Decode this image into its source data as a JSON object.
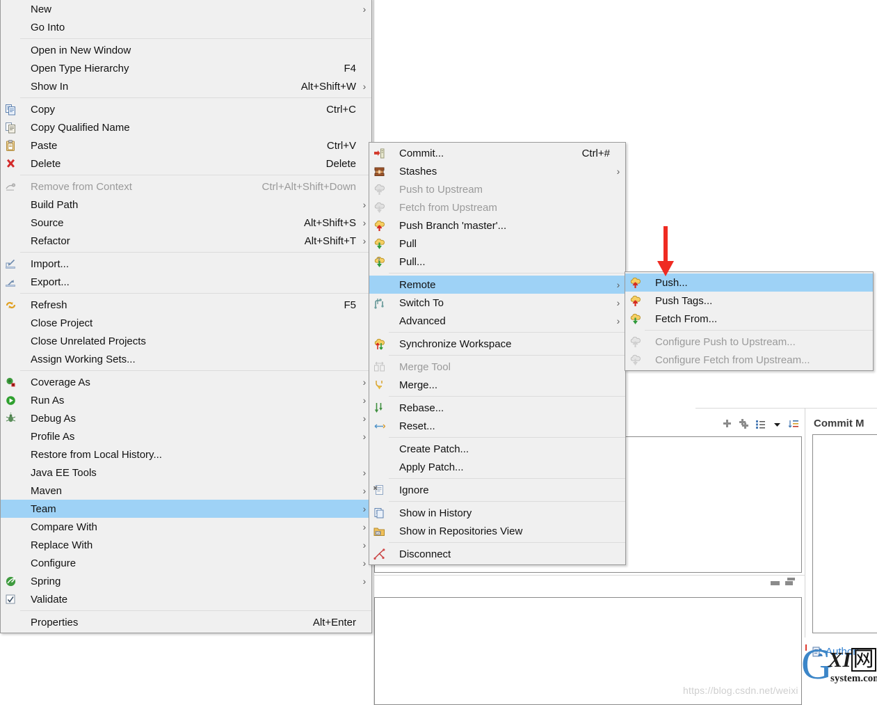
{
  "context_menu": {
    "name": "project-context-menu",
    "groups": [
      {
        "items": [
          {
            "label": "New",
            "icon": "none",
            "accel": "",
            "submenu": true,
            "disabled": false,
            "selected": false
          },
          {
            "label": "Go Into",
            "icon": "none",
            "accel": "",
            "submenu": false,
            "disabled": false,
            "selected": false
          }
        ]
      },
      {
        "items": [
          {
            "label": "Open in New Window",
            "icon": "none",
            "accel": "",
            "submenu": false,
            "disabled": false,
            "selected": false
          },
          {
            "label": "Open Type Hierarchy",
            "icon": "none",
            "accel": "F4",
            "submenu": false,
            "disabled": false,
            "selected": false
          },
          {
            "label": "Show In",
            "icon": "none",
            "accel": "Alt+Shift+W",
            "submenu": true,
            "disabled": false,
            "selected": false
          }
        ]
      },
      {
        "items": [
          {
            "label": "Copy",
            "icon": "copy-icon",
            "accel": "Ctrl+C",
            "submenu": false,
            "disabled": false,
            "selected": false
          },
          {
            "label": "Copy Qualified Name",
            "icon": "copy-qualified-icon",
            "accel": "",
            "submenu": false,
            "disabled": false,
            "selected": false
          },
          {
            "label": "Paste",
            "icon": "paste-icon",
            "accel": "Ctrl+V",
            "submenu": false,
            "disabled": false,
            "selected": false
          },
          {
            "label": "Delete",
            "icon": "delete-icon",
            "accel": "Delete",
            "submenu": false,
            "disabled": false,
            "selected": false
          }
        ]
      },
      {
        "items": [
          {
            "label": "Remove from Context",
            "icon": "remove-context-icon",
            "accel": "Ctrl+Alt+Shift+Down",
            "submenu": false,
            "disabled": true,
            "selected": false
          },
          {
            "label": "Build Path",
            "icon": "none",
            "accel": "",
            "submenu": true,
            "disabled": false,
            "selected": false
          },
          {
            "label": "Source",
            "icon": "none",
            "accel": "Alt+Shift+S",
            "submenu": true,
            "disabled": false,
            "selected": false
          },
          {
            "label": "Refactor",
            "icon": "none",
            "accel": "Alt+Shift+T",
            "submenu": true,
            "disabled": false,
            "selected": false
          }
        ]
      },
      {
        "items": [
          {
            "label": "Import...",
            "icon": "import-icon",
            "accel": "",
            "submenu": false,
            "disabled": false,
            "selected": false
          },
          {
            "label": "Export...",
            "icon": "export-icon",
            "accel": "",
            "submenu": false,
            "disabled": false,
            "selected": false
          }
        ]
      },
      {
        "items": [
          {
            "label": "Refresh",
            "icon": "refresh-icon",
            "accel": "F5",
            "submenu": false,
            "disabled": false,
            "selected": false
          },
          {
            "label": "Close Project",
            "icon": "none",
            "accel": "",
            "submenu": false,
            "disabled": false,
            "selected": false
          },
          {
            "label": "Close Unrelated Projects",
            "icon": "none",
            "accel": "",
            "submenu": false,
            "disabled": false,
            "selected": false
          },
          {
            "label": "Assign Working Sets...",
            "icon": "none",
            "accel": "",
            "submenu": false,
            "disabled": false,
            "selected": false
          }
        ]
      },
      {
        "items": [
          {
            "label": "Coverage As",
            "icon": "coverage-icon",
            "accel": "",
            "submenu": true,
            "disabled": false,
            "selected": false
          },
          {
            "label": "Run As",
            "icon": "run-icon",
            "accel": "",
            "submenu": true,
            "disabled": false,
            "selected": false
          },
          {
            "label": "Debug As",
            "icon": "debug-icon",
            "accel": "",
            "submenu": true,
            "disabled": false,
            "selected": false
          },
          {
            "label": "Profile As",
            "icon": "none",
            "accel": "",
            "submenu": true,
            "disabled": false,
            "selected": false
          },
          {
            "label": "Restore from Local History...",
            "icon": "none",
            "accel": "",
            "submenu": false,
            "disabled": false,
            "selected": false
          },
          {
            "label": "Java EE Tools",
            "icon": "none",
            "accel": "",
            "submenu": true,
            "disabled": false,
            "selected": false
          },
          {
            "label": "Maven",
            "icon": "none",
            "accel": "",
            "submenu": true,
            "disabled": false,
            "selected": false
          },
          {
            "label": "Team",
            "icon": "none",
            "accel": "",
            "submenu": true,
            "disabled": false,
            "selected": true
          },
          {
            "label": "Compare With",
            "icon": "none",
            "accel": "",
            "submenu": true,
            "disabled": false,
            "selected": false
          },
          {
            "label": "Replace With",
            "icon": "none",
            "accel": "",
            "submenu": true,
            "disabled": false,
            "selected": false
          },
          {
            "label": "Configure",
            "icon": "none",
            "accel": "",
            "submenu": true,
            "disabled": false,
            "selected": false
          },
          {
            "label": "Spring",
            "icon": "spring-icon",
            "accel": "",
            "submenu": true,
            "disabled": false,
            "selected": false
          },
          {
            "label": "Validate",
            "icon": "validate-checkbox-icon",
            "accel": "",
            "submenu": false,
            "disabled": false,
            "selected": false
          }
        ]
      },
      {
        "items": [
          {
            "label": "Properties",
            "icon": "none",
            "accel": "Alt+Enter",
            "submenu": false,
            "disabled": false,
            "selected": false
          }
        ]
      }
    ]
  },
  "team_menu": {
    "name": "team-submenu",
    "groups": [
      {
        "items": [
          {
            "label": "Commit...",
            "icon": "commit-icon",
            "accel": "Ctrl+#",
            "submenu": false,
            "disabled": false,
            "selected": false
          },
          {
            "label": "Stashes",
            "icon": "stashes-icon",
            "accel": "",
            "submenu": true,
            "disabled": false,
            "selected": false
          },
          {
            "label": "Push to Upstream",
            "icon": "push-upstream-icon",
            "accel": "",
            "submenu": false,
            "disabled": true,
            "selected": false
          },
          {
            "label": "Fetch from Upstream",
            "icon": "fetch-upstream-icon",
            "accel": "",
            "submenu": false,
            "disabled": true,
            "selected": false
          },
          {
            "label": "Push Branch 'master'...",
            "icon": "push-branch-icon",
            "accel": "",
            "submenu": false,
            "disabled": false,
            "selected": false
          },
          {
            "label": "Pull",
            "icon": "pull-icon",
            "accel": "",
            "submenu": false,
            "disabled": false,
            "selected": false
          },
          {
            "label": "Pull...",
            "icon": "pull-config-icon",
            "accel": "",
            "submenu": false,
            "disabled": false,
            "selected": false
          }
        ]
      },
      {
        "items": [
          {
            "label": "Remote",
            "icon": "none",
            "accel": "",
            "submenu": true,
            "disabled": false,
            "selected": true
          },
          {
            "label": "Switch To",
            "icon": "switch-to-icon",
            "accel": "",
            "submenu": true,
            "disabled": false,
            "selected": false
          },
          {
            "label": "Advanced",
            "icon": "none",
            "accel": "",
            "submenu": true,
            "disabled": false,
            "selected": false
          }
        ]
      },
      {
        "items": [
          {
            "label": "Synchronize Workspace",
            "icon": "synchronize-icon",
            "accel": "",
            "submenu": false,
            "disabled": false,
            "selected": false
          }
        ]
      },
      {
        "items": [
          {
            "label": "Merge Tool",
            "icon": "merge-tool-icon",
            "accel": "",
            "submenu": false,
            "disabled": true,
            "selected": false
          },
          {
            "label": "Merge...",
            "icon": "merge-icon",
            "accel": "",
            "submenu": false,
            "disabled": false,
            "selected": false
          }
        ]
      },
      {
        "items": [
          {
            "label": "Rebase...",
            "icon": "rebase-icon",
            "accel": "",
            "submenu": false,
            "disabled": false,
            "selected": false
          },
          {
            "label": "Reset...",
            "icon": "reset-icon",
            "accel": "",
            "submenu": false,
            "disabled": false,
            "selected": false
          }
        ]
      },
      {
        "items": [
          {
            "label": "Create Patch...",
            "icon": "none",
            "accel": "",
            "submenu": false,
            "disabled": false,
            "selected": false
          },
          {
            "label": "Apply Patch...",
            "icon": "none",
            "accel": "",
            "submenu": false,
            "disabled": false,
            "selected": false
          }
        ]
      },
      {
        "items": [
          {
            "label": "Ignore",
            "icon": "ignore-icon",
            "accel": "",
            "submenu": false,
            "disabled": false,
            "selected": false
          }
        ]
      },
      {
        "items": [
          {
            "label": "Show in History",
            "icon": "history-icon",
            "accel": "",
            "submenu": false,
            "disabled": false,
            "selected": false
          },
          {
            "label": "Show in Repositories View",
            "icon": "repositories-icon",
            "accel": "",
            "submenu": false,
            "disabled": false,
            "selected": false
          }
        ]
      },
      {
        "items": [
          {
            "label": "Disconnect",
            "icon": "disconnect-icon",
            "accel": "",
            "submenu": false,
            "disabled": false,
            "selected": false
          }
        ]
      }
    ]
  },
  "remote_menu": {
    "name": "remote-submenu",
    "groups": [
      {
        "items": [
          {
            "label": "Push...",
            "icon": "push-icon",
            "accel": "",
            "submenu": false,
            "disabled": false,
            "selected": true
          },
          {
            "label": "Push Tags...",
            "icon": "push-tags-icon",
            "accel": "",
            "submenu": false,
            "disabled": false,
            "selected": false
          },
          {
            "label": "Fetch From...",
            "icon": "fetch-from-icon",
            "accel": "",
            "submenu": false,
            "disabled": false,
            "selected": false
          }
        ]
      },
      {
        "items": [
          {
            "label": "Configure Push to Upstream...",
            "icon": "configure-push-icon",
            "accel": "",
            "submenu": false,
            "disabled": true,
            "selected": false
          },
          {
            "label": "Configure Fetch from Upstream...",
            "icon": "configure-fetch-icon",
            "accel": "",
            "submenu": false,
            "disabled": true,
            "selected": false
          }
        ]
      }
    ]
  },
  "workbench": {
    "commit_panel_title": "Commit M",
    "author_label": "Author:"
  },
  "watermarks": {
    "url": "https://blog.csdn.net/weixi",
    "logo_g": "G",
    "logo_xi": "XI",
    "logo_wang": "网",
    "logo_domain": "system.com"
  },
  "colors": {
    "menu_bg": "#f0f0f0",
    "menu_border": "#9a9a9a",
    "highlight": "#9ed2f6",
    "text": "#1a1a1a",
    "disabled_text": "#9a9a9a",
    "separator": "#dcdcdc",
    "accent_red": "#e8241c",
    "link_blue": "#2f7fd0"
  }
}
